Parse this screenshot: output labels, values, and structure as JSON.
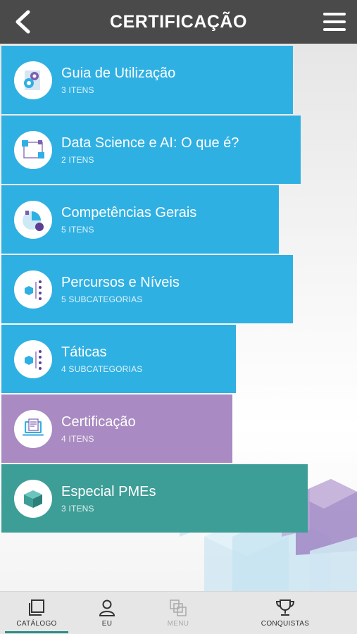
{
  "header": {
    "title": "CERTIFICAÇÃO"
  },
  "items": [
    {
      "name": "Guia de Utilização",
      "count": "3 ITENS",
      "color": "#2fb0e3",
      "icon": "gears-icon"
    },
    {
      "name": "Data Science e AI: O que é?",
      "count": "2 ITENS",
      "color": "#2fb0e3",
      "icon": "cube-flow-icon"
    },
    {
      "name": "Competências Gerais",
      "count": "5 ITENS",
      "color": "#2fb0e3",
      "icon": "pie-chart-icon"
    },
    {
      "name": "Percursos e Níveis",
      "count": "5 SUBCATEGORIAS",
      "color": "#2fb0e3",
      "icon": "cube-tree-icon"
    },
    {
      "name": "Táticas",
      "count": "4 SUBCATEGORIAS",
      "color": "#2fb0e3",
      "icon": "cube-tree-icon"
    },
    {
      "name": "Certificação",
      "count": "4 ITENS",
      "color": "#a98ac2",
      "icon": "laptop-document-icon"
    },
    {
      "name": "Especial PMEs",
      "count": "3 ITENS",
      "color": "#3d9e97",
      "icon": "cube-icon"
    }
  ],
  "bottom_nav": [
    {
      "label": "CATÁLOGO",
      "icon": "catalog-icon",
      "active": true
    },
    {
      "label": "EU",
      "icon": "user-icon"
    },
    {
      "label": "MENU",
      "icon": "menu-stack-icon",
      "disabled": true
    },
    {
      "label": "CONQUISTAS",
      "icon": "trophy-icon"
    }
  ]
}
